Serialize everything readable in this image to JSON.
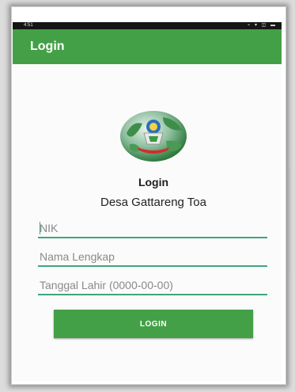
{
  "status_bar": {
    "time": "4:51",
    "icons": "⌁ ▾ ◫ ▬"
  },
  "app_bar": {
    "title": "Login"
  },
  "form": {
    "title": "Login",
    "subtitle": "Desa Gattareng Toa",
    "nik_placeholder": "NIK",
    "nama_placeholder": "Nama Lengkap",
    "tanggal_placeholder": "Tanggal Lahir (0000-00-00)",
    "login_button": "LOGIN"
  },
  "colors": {
    "app_bar": "#43a047",
    "field_underline": "#3fa67a",
    "button": "#43a047"
  },
  "icons": [
    "globe-emblem-logo-icon"
  ]
}
